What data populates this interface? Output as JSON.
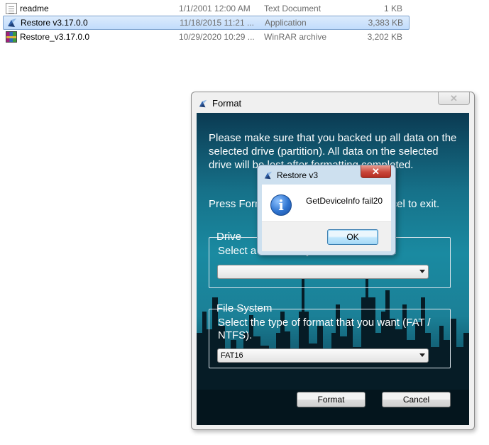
{
  "file_list": [
    {
      "name": "readme",
      "date": "1/1/2001 12:00 AM",
      "type": "Text Document",
      "size": "1 KB",
      "icon": "text-document-icon",
      "selected": false
    },
    {
      "name": "Restore v3.17.0.0",
      "date": "11/18/2015 11:21 ...",
      "type": "Application",
      "size": "3,383 KB",
      "icon": "application-icon",
      "selected": true
    },
    {
      "name": "Restore_v3.17.0.0",
      "date": "10/29/2020 10:29 ...",
      "type": "WinRAR archive",
      "size": "3,202 KB",
      "icon": "winrar-archive-icon",
      "selected": false
    }
  ],
  "format_window": {
    "title": "Format",
    "close_glyph": "✕",
    "message_line": "Please make sure that you backed up all data on the selected drive (partition).  All data on the selected drive will be lost after formatting completed.",
    "press_line": "Press Format to continue or press Cancel to exit.",
    "drive_group": {
      "label": "Drive",
      "description": "Select a drive that you want to format.",
      "selected_value": ""
    },
    "fs_group": {
      "label": "File System",
      "description": "Select the type of format that you want (FAT / NTFS).",
      "selected_value": "FAT16"
    },
    "format_button": "Format",
    "cancel_button": "Cancel"
  },
  "message_box": {
    "title": "Restore v3",
    "close_glyph": "✕",
    "message": "GetDeviceInfo fail20",
    "icon": "information-icon",
    "icon_glyph": "i",
    "ok_button": "OK"
  },
  "colors": {
    "selection_bg": "#c1dcfc",
    "dialog_bg": "#f0f0f0",
    "client_gradient_mid": "#1a8aa1",
    "close_red": "#c9463a"
  }
}
